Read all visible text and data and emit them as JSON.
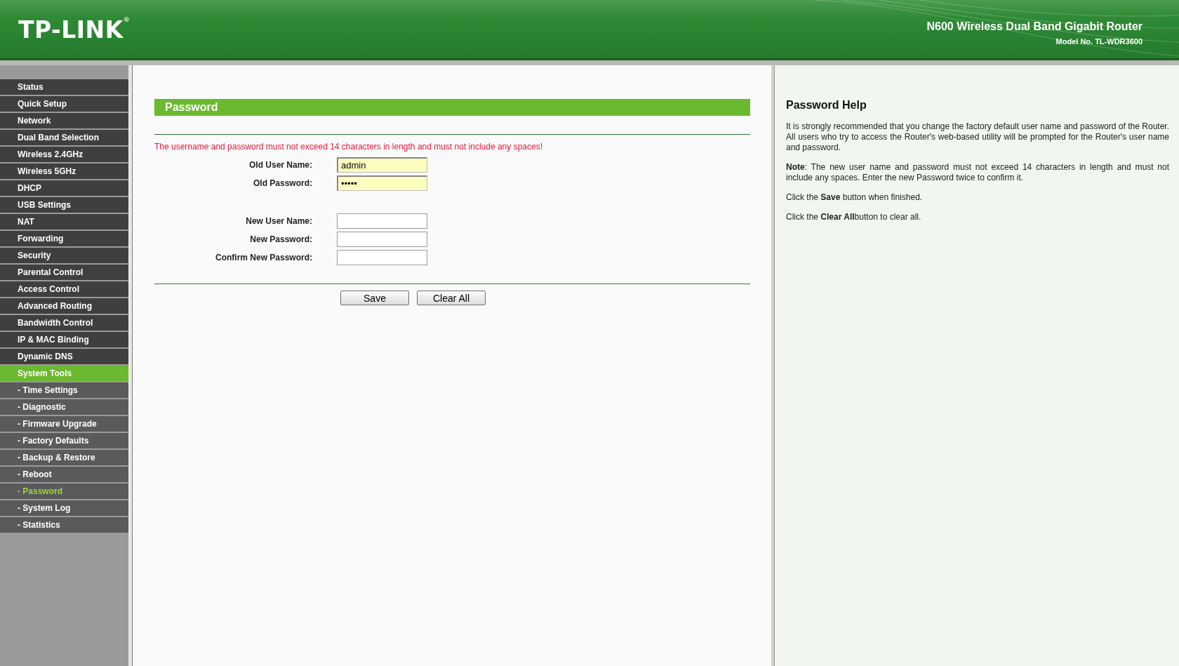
{
  "header": {
    "logo": "TP-LINK",
    "registered_mark": "®",
    "product": "N600 Wireless Dual Band Gigabit Router",
    "model": "Model No. TL-WDR3600"
  },
  "sidebar": {
    "items": [
      {
        "label": "Status",
        "kind": "main",
        "selected": false
      },
      {
        "label": "Quick Setup",
        "kind": "main",
        "selected": false
      },
      {
        "label": "Network",
        "kind": "main",
        "selected": false
      },
      {
        "label": "Dual Band Selection",
        "kind": "main",
        "selected": false
      },
      {
        "label": "Wireless 2.4GHz",
        "kind": "main",
        "selected": false
      },
      {
        "label": "Wireless 5GHz",
        "kind": "main",
        "selected": false
      },
      {
        "label": "DHCP",
        "kind": "main",
        "selected": false
      },
      {
        "label": "USB Settings",
        "kind": "main",
        "selected": false
      },
      {
        "label": "NAT",
        "kind": "main",
        "selected": false
      },
      {
        "label": "Forwarding",
        "kind": "main",
        "selected": false
      },
      {
        "label": "Security",
        "kind": "main",
        "selected": false
      },
      {
        "label": "Parental Control",
        "kind": "main",
        "selected": false
      },
      {
        "label": "Access Control",
        "kind": "main",
        "selected": false
      },
      {
        "label": "Advanced Routing",
        "kind": "main",
        "selected": false
      },
      {
        "label": "Bandwidth Control",
        "kind": "main",
        "selected": false
      },
      {
        "label": "IP & MAC Binding",
        "kind": "main",
        "selected": false
      },
      {
        "label": "Dynamic DNS",
        "kind": "main",
        "selected": false
      },
      {
        "label": "System Tools",
        "kind": "main",
        "selected": true
      },
      {
        "label": "- Time Settings",
        "kind": "sub",
        "selected": false
      },
      {
        "label": "- Diagnostic",
        "kind": "sub",
        "selected": false
      },
      {
        "label": "- Firmware Upgrade",
        "kind": "sub",
        "selected": false
      },
      {
        "label": "- Factory Defaults",
        "kind": "sub",
        "selected": false
      },
      {
        "label": "- Backup & Restore",
        "kind": "sub",
        "selected": false
      },
      {
        "label": "- Reboot",
        "kind": "sub",
        "selected": false
      },
      {
        "label": "- Password",
        "kind": "sub",
        "selected": true
      },
      {
        "label": "- System Log",
        "kind": "sub",
        "selected": false
      },
      {
        "label": "- Statistics",
        "kind": "sub",
        "selected": false
      }
    ]
  },
  "main": {
    "title": "Password",
    "warning": "The username and password must not exceed 14 characters in length and must not include any spaces!",
    "old_fields": [
      {
        "label": "Old User Name:",
        "value": "admin"
      },
      {
        "label": "Old Password:",
        "value": "•••••"
      }
    ],
    "new_fields": [
      {
        "label": "New User Name:"
      },
      {
        "label": "New Password:"
      },
      {
        "label": "Confirm New Password:"
      }
    ],
    "buttons": [
      "Save",
      "Clear All"
    ]
  },
  "help": {
    "title": "Password Help",
    "paragraphs": [
      "It is strongly recommended that you change the factory default user name and password of the Router. All users who try to access the Router's web-based utility will be prompted for the Router's user name and password.",
      "**Note**: The new user name and password must not exceed 14 characters in length and must not include any spaces. Enter the new Password twice to confirm it.",
      "Click the **Save** button when finished.",
      "Click the **Clear All**button to clear all."
    ]
  }
}
